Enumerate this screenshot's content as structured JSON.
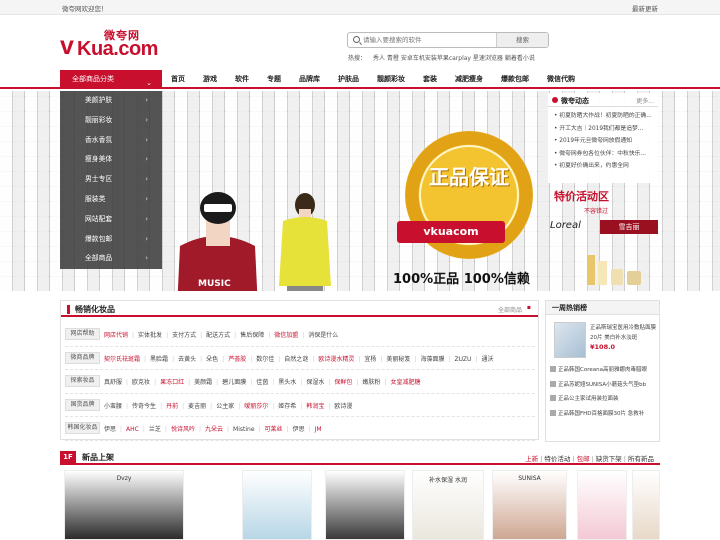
{
  "topbar": {
    "welcome": "微夸网欢迎您！",
    "latest": "最新更新"
  },
  "logo": {
    "cn": "微夸网",
    "v": "v",
    "kua": "Kua.com"
  },
  "search": {
    "placeholder": "请输入要搜索的软件",
    "button": "搜索"
  },
  "hot_search": {
    "label": "热搜：",
    "items": [
      "秀人",
      "青橙",
      "安卓车机安装苹果carplay",
      "星速浏览器",
      "躺着看小说"
    ]
  },
  "nav": {
    "all_categories": "全部商品分类",
    "items": [
      "首页",
      "游戏",
      "软件",
      "专题",
      "品牌库",
      "护肤品",
      "靓颜彩妆",
      "套装",
      "减肥瘦身",
      "爆款包邮",
      "微信代购"
    ]
  },
  "category_menu": [
    "美颜护肤",
    "靓丽彩妆",
    "香水香氛",
    "瘦身美体",
    "男士专区",
    "服装类",
    "网站配套",
    "爆款包邮",
    "全部商品"
  ],
  "banner": {
    "badge_text": "正品保证",
    "ribbon": "vkuacom",
    "slogan": "100%正品 100%信赖",
    "promo_title": "特价活动区",
    "promo_sub": "不容错过",
    "brand1": "Loreal",
    "brand2": "雪吉丽"
  },
  "news": {
    "title": "微夸动态",
    "more": "更多...",
    "items": [
      "初夏防晒大作战！初夏防晒的正确...",
      "开工大吉｜2019我们都是追梦...",
      "2019年元旦微夸网放假通知",
      "微夸网券包各位伙伴：中秋快乐...",
      "初夏好价确出来，约惠全网"
    ]
  },
  "hot_section": {
    "title": "畅销化妆品",
    "all": "全部商品",
    "rows": [
      {
        "label": "网店帮助",
        "links": [
          "网店代销",
          "实体批发",
          "支付方式",
          "配送方式",
          "售后保障",
          "微信加盟",
          "消保是什么"
        ],
        "red": [
          0,
          5
        ]
      },
      {
        "label": "微商品牌",
        "links": [
          "契尔氏祛斑霜",
          "黑脸霜",
          "去黄头",
          "朵色",
          "芦荟胶",
          "数尔佳",
          "自然之谜",
          "欧诗漫水精灵",
          "宜杨",
          "美丽秘笈",
          "海藻面膜",
          "ZUZU",
          "通沃"
        ],
        "red": [
          0,
          4,
          7
        ]
      },
      {
        "label": "探索妆品",
        "links": [
          "真舒服",
          "欧克妆",
          "果冻口红",
          "美颜霜",
          "碧儿面膜",
          "佳茵",
          "黑头水",
          "保湿水",
          "保鲜包",
          "嫩肤粉",
          "女皇减肥糖"
        ],
        "red": [
          2,
          8,
          10
        ]
      },
      {
        "label": "国货品牌",
        "links": [
          "小蛮腰",
          "传奇今生",
          "丹前",
          "麦吉丽",
          "公主家",
          "嗳丽莎尔",
          "姬存希",
          "韩润宝",
          "欧诗漫"
        ],
        "red": [
          2,
          5,
          7
        ]
      },
      {
        "label": "韩国化妆品",
        "links": [
          "伊思",
          "AHC",
          "兰芝",
          "悦诗风吟",
          "九朵云",
          "Mistine",
          "可莱丝",
          "伊思",
          "JM"
        ],
        "red": [
          1,
          3,
          4,
          6,
          8
        ]
      }
    ]
  },
  "rank": {
    "title": "一周热销榜",
    "top_text": "正品斯瑞宝医用冷敷贴面膜20片 美白补水淡斑",
    "top_price": "¥108.0",
    "items": [
      "正品韩国Coreana高丽雅娜肉毒腊眼",
      "正品苏妮娅SUNISA小蘑菇头气垫bb",
      "正品公主家试用装拉面装",
      "正品韩国FHD百格面膜30片 急救补"
    ]
  },
  "new_section": {
    "floor": "1F",
    "title": "新品上架",
    "tabs": [
      "上新",
      "特价活动",
      "包邮",
      "缺货下架",
      "所有新品"
    ],
    "red_tabs": [
      0,
      2
    ]
  },
  "products": [
    {
      "label": "Dvzy",
      "color": "#2b2b2b"
    },
    {
      "label": "",
      "color": "#b7d6e6"
    },
    {
      "label": "",
      "color": "#3a3a3a"
    },
    {
      "label": "补水保湿 水润",
      "color": "#eae7dd"
    },
    {
      "label": "SUNISA",
      "color": "#cfa792"
    },
    {
      "label": "",
      "color": "#f3c9d5"
    },
    {
      "label": "",
      "color": "#e8d8c8"
    }
  ],
  "colors": {
    "brand_red": "#c8102e",
    "gold": "#f4c430"
  }
}
